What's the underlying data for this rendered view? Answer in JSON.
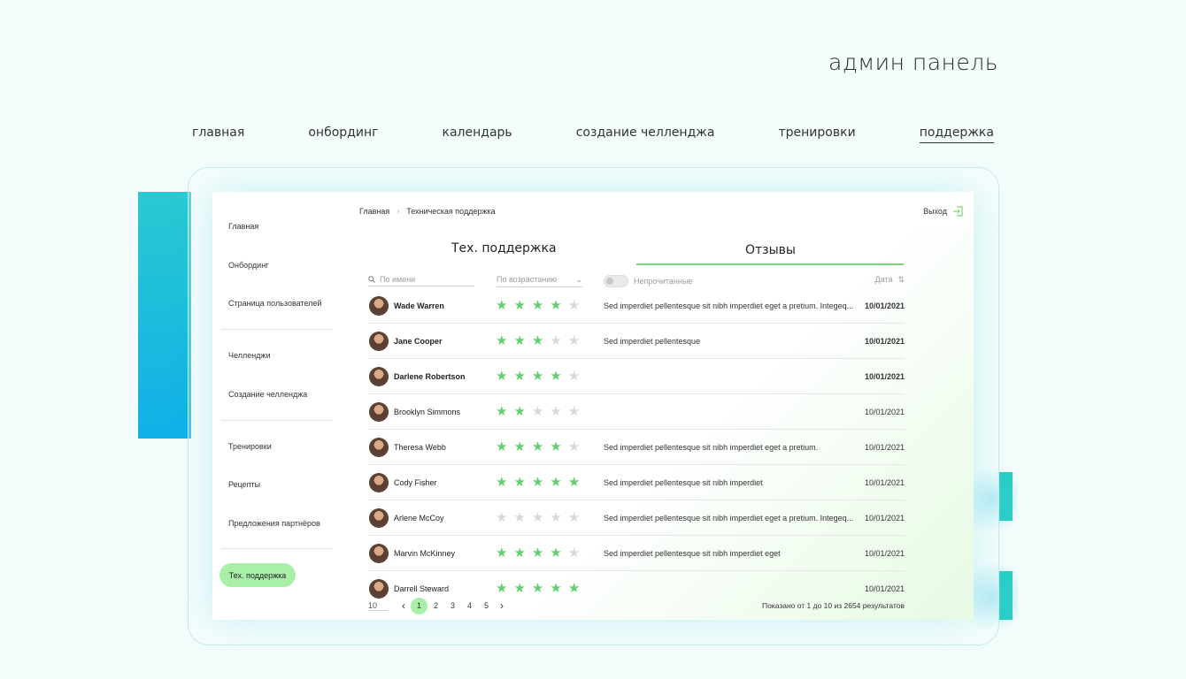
{
  "header": {
    "title": "админ панель"
  },
  "topnav": [
    "главная",
    "онбординг",
    "календарь",
    "создание челленджа",
    "тренировки",
    "поддержка"
  ],
  "sidebar": {
    "items": [
      "Главная",
      "Онбординг",
      "Страница пользователей",
      "Челленджи",
      "Создание челленджа",
      "Тренировки",
      "Рецепты",
      "Предложения партнёров"
    ],
    "active": "Тех. поддержка"
  },
  "breadcrumb": {
    "home": "Главная",
    "current": "Техническая поддержка"
  },
  "logout": "Выход",
  "tabs": [
    "Тех. поддержка",
    "Отзывы"
  ],
  "filters": {
    "search_placeholder": "По имени",
    "sort": "По возрастанию",
    "unread": "Непрочитанные",
    "date": "Дата"
  },
  "reviews": [
    {
      "name": "Wade Warren",
      "rating": 4,
      "text": "Sed imperdiet pellentesque sit nibh imperdiet eget a pretium. Integeq...",
      "date": "10/01/2021",
      "unread": true
    },
    {
      "name": "Jane Cooper",
      "rating": 3,
      "text": "Sed imperdiet pellentesque",
      "date": "10/01/2021",
      "unread": true
    },
    {
      "name": "Darlene Robertson",
      "rating": 4,
      "text": "",
      "date": "10/01/2021",
      "unread": true
    },
    {
      "name": "Brooklyn Simmons",
      "rating": 2,
      "text": "",
      "date": "10/01/2021",
      "unread": false
    },
    {
      "name": "Theresa Webb",
      "rating": 4,
      "text": "Sed imperdiet pellentesque sit nibh imperdiet eget a pretium.",
      "date": "10/01/2021",
      "unread": false
    },
    {
      "name": "Cody Fisher",
      "rating": 5,
      "text": "Sed imperdiet pellentesque sit nibh imperdiet",
      "date": "10/01/2021",
      "unread": false
    },
    {
      "name": "Arlene McCoy",
      "rating": 0,
      "text": "Sed imperdiet pellentesque sit nibh imperdiet eget a pretium. Integeq...",
      "date": "10/01/2021",
      "unread": false
    },
    {
      "name": "Marvin McKinney",
      "rating": 4,
      "text": "Sed imperdiet pellentesque sit nibh imperdiet eget",
      "date": "10/01/2021",
      "unread": false
    },
    {
      "name": "Darrell Steward",
      "rating": 5,
      "text": "",
      "date": "10/01/2021",
      "unread": false
    }
  ],
  "pagination": {
    "per_page": "10",
    "pages": [
      "1",
      "2",
      "3",
      "4",
      "5"
    ],
    "current": "1",
    "info": "Показано от 1 до 10 из 2654 результатов"
  },
  "colors": {
    "accent": "#7bd37b",
    "star": "#62cf73",
    "active_pill": "#a8f0a8",
    "deco": "#26d0c0"
  }
}
